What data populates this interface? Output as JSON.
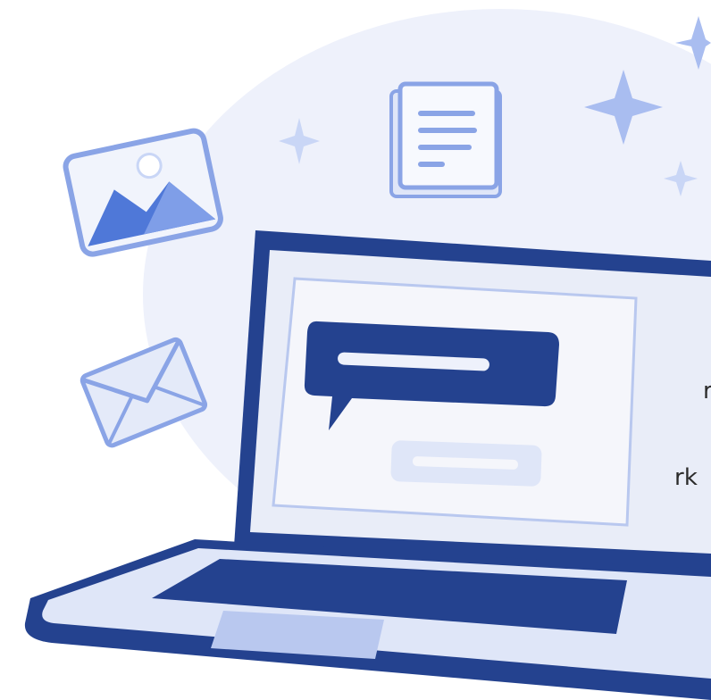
{
  "colors": {
    "background": "#ffffff",
    "halo": "#eef1fb",
    "navy": "#24428f",
    "mid_blue": "#4f78d8",
    "light_blue": "#a9bdf0",
    "pale_blue": "#dfe6f8",
    "screen_bg": "#e9edf8",
    "dialog_bg": "#f5f6fb",
    "text": "#2b2b2b"
  },
  "text_fragments": {
    "line1": "r",
    "line2": "rk"
  },
  "icons": {
    "image": "image-icon",
    "document": "document-icon",
    "envelope": "envelope-icon",
    "sparkles": "sparkle-icon",
    "chat": "chat-bubble-icon",
    "laptop": "laptop-icon"
  }
}
